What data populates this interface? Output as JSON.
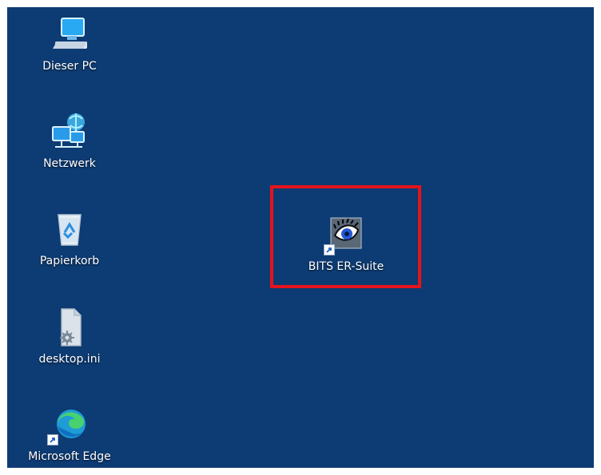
{
  "desktop": {
    "background": "#0d3b73",
    "icons": [
      {
        "label": "Dieser PC",
        "icon": "monitor-icon"
      },
      {
        "label": "Netzwerk",
        "icon": "network-icon"
      },
      {
        "label": "Papierkorb",
        "icon": "recycle-bin-icon"
      },
      {
        "label": "desktop.ini",
        "icon": "settings-file-icon"
      },
      {
        "label": "Microsoft Edge",
        "icon": "edge-icon"
      }
    ],
    "highlight": {
      "label": "BITS ER-Suite",
      "icon": "bits-er-suite-eye-icon",
      "border_color": "#e6131b"
    }
  }
}
